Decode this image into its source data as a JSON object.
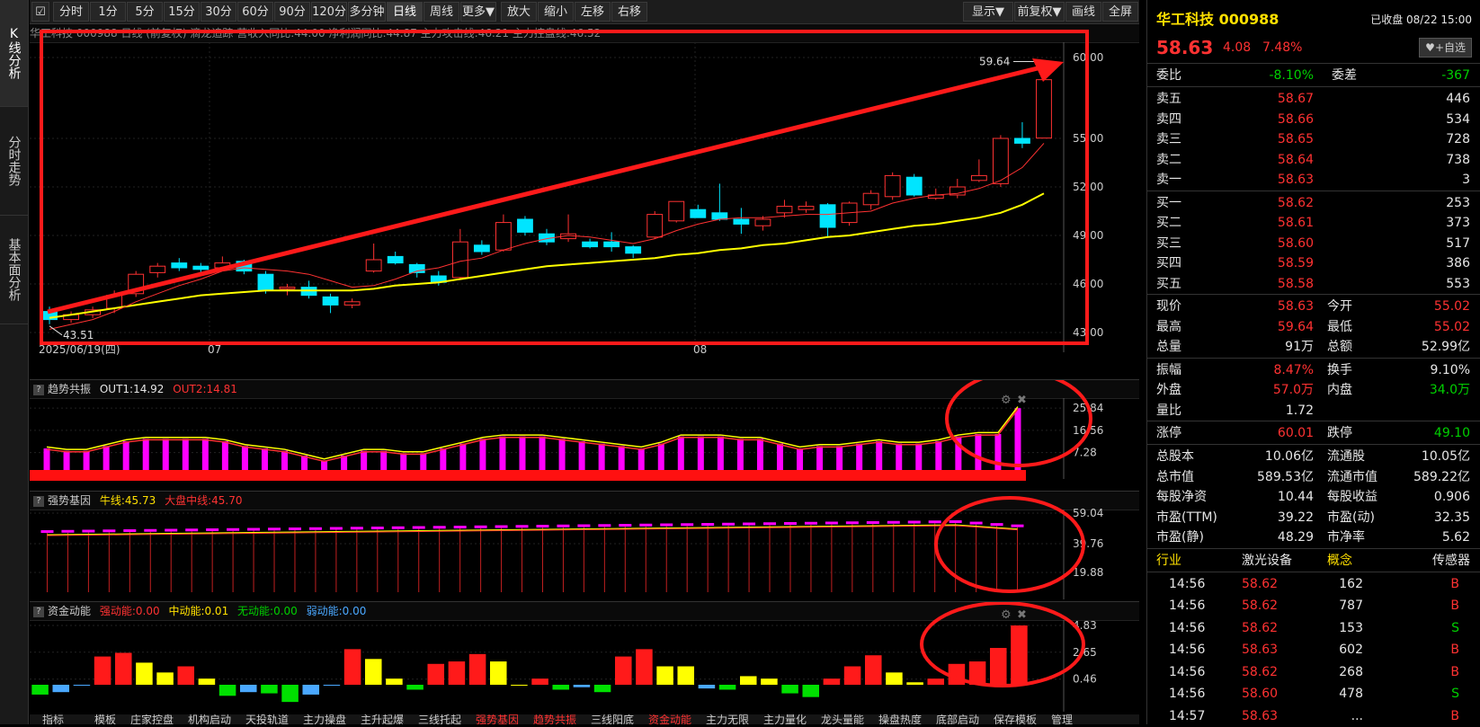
{
  "left_tabs": [
    {
      "label": "K线分析",
      "active": true
    },
    {
      "label": "分时走势",
      "active": false
    },
    {
      "label": "基本面分析",
      "active": false
    }
  ],
  "toolbar": {
    "periods": [
      "分时",
      "1分",
      "5分",
      "15分",
      "30分",
      "60分",
      "90分",
      "120分",
      "多分钟",
      "日线",
      "周线",
      "更多▼"
    ],
    "active_period": "日线",
    "actions": [
      "放大",
      "缩小",
      "左移",
      "右移"
    ],
    "right_actions": [
      "显示▼",
      "前复权▼",
      "画线",
      "全屏"
    ]
  },
  "main_panel": {
    "header": "华工科技 000988 日线 (前复权) 滴龙追踪 营收入同比:44.00 净利润同比:44.87 主力攻击线:46.21 主力控盘线:46.52",
    "y_ticks": [
      "60.00",
      "55.00",
      "52.00",
      "49.00",
      "46.00",
      "43.00"
    ],
    "x_labels": [
      "2025/06/19(四)",
      "07",
      "08"
    ],
    "high_label": "59.64",
    "low_label": "43.51",
    "colors": {
      "up": "#ff3232",
      "down": "#00e5ff",
      "ma5": "#ff3232",
      "ma20": "#ffff00",
      "annotation": "#ff1a1a"
    }
  },
  "chart_data": {
    "type": "candlestick",
    "ylim": [
      42.5,
      60.5
    ],
    "candles": [
      {
        "o": 44.3,
        "h": 44.6,
        "l": 43.51,
        "c": 43.8
      },
      {
        "o": 43.8,
        "h": 44.3,
        "l": 43.6,
        "c": 44.1
      },
      {
        "o": 44.1,
        "h": 44.6,
        "l": 43.9,
        "c": 44.4
      },
      {
        "o": 44.5,
        "h": 45.6,
        "l": 44.2,
        "c": 45.3
      },
      {
        "o": 45.4,
        "h": 46.8,
        "l": 45.2,
        "c": 46.6
      },
      {
        "o": 46.7,
        "h": 47.3,
        "l": 46.4,
        "c": 47.1
      },
      {
        "o": 47.3,
        "h": 47.6,
        "l": 46.8,
        "c": 47.0
      },
      {
        "o": 47.1,
        "h": 47.3,
        "l": 46.7,
        "c": 46.9
      },
      {
        "o": 47.0,
        "h": 47.7,
        "l": 46.9,
        "c": 47.3
      },
      {
        "o": 47.4,
        "h": 47.5,
        "l": 46.6,
        "c": 46.8
      },
      {
        "o": 46.6,
        "h": 46.8,
        "l": 45.4,
        "c": 45.6
      },
      {
        "o": 45.7,
        "h": 46.0,
        "l": 45.3,
        "c": 45.8
      },
      {
        "o": 45.8,
        "h": 46.2,
        "l": 45.1,
        "c": 45.3
      },
      {
        "o": 45.2,
        "h": 45.4,
        "l": 44.2,
        "c": 44.7
      },
      {
        "o": 44.7,
        "h": 45.1,
        "l": 44.5,
        "c": 44.9
      },
      {
        "o": 46.8,
        "h": 48.5,
        "l": 46.7,
        "c": 47.5
      },
      {
        "o": 47.7,
        "h": 48.0,
        "l": 47.2,
        "c": 47.3
      },
      {
        "o": 47.2,
        "h": 47.3,
        "l": 46.4,
        "c": 46.7
      },
      {
        "o": 46.5,
        "h": 46.8,
        "l": 45.9,
        "c": 46.1
      },
      {
        "o": 46.4,
        "h": 49.4,
        "l": 46.3,
        "c": 48.6
      },
      {
        "o": 48.4,
        "h": 48.7,
        "l": 47.8,
        "c": 48.0
      },
      {
        "o": 48.1,
        "h": 50.3,
        "l": 48.0,
        "c": 49.8
      },
      {
        "o": 50.0,
        "h": 50.2,
        "l": 49.0,
        "c": 49.2
      },
      {
        "o": 49.1,
        "h": 49.4,
        "l": 48.4,
        "c": 48.6
      },
      {
        "o": 48.8,
        "h": 50.3,
        "l": 48.6,
        "c": 49.1
      },
      {
        "o": 48.6,
        "h": 48.8,
        "l": 48.2,
        "c": 48.3
      },
      {
        "o": 48.6,
        "h": 49.2,
        "l": 48.0,
        "c": 48.3
      },
      {
        "o": 48.3,
        "h": 48.4,
        "l": 47.6,
        "c": 47.9
      },
      {
        "o": 48.9,
        "h": 50.5,
        "l": 48.8,
        "c": 50.3
      },
      {
        "o": 49.9,
        "h": 51.1,
        "l": 49.8,
        "c": 51.1
      },
      {
        "o": 50.6,
        "h": 50.9,
        "l": 50.1,
        "c": 50.1
      },
      {
        "o": 50.4,
        "h": 52.2,
        "l": 49.9,
        "c": 50.0
      },
      {
        "o": 50.0,
        "h": 50.7,
        "l": 49.1,
        "c": 49.7
      },
      {
        "o": 49.6,
        "h": 50.2,
        "l": 49.3,
        "c": 50.0
      },
      {
        "o": 50.4,
        "h": 51.2,
        "l": 50.1,
        "c": 50.8
      },
      {
        "o": 50.6,
        "h": 51.1,
        "l": 50.4,
        "c": 50.8
      },
      {
        "o": 50.9,
        "h": 51.0,
        "l": 48.9,
        "c": 49.5
      },
      {
        "o": 49.8,
        "h": 51.1,
        "l": 49.6,
        "c": 51.0
      },
      {
        "o": 50.9,
        "h": 51.8,
        "l": 50.6,
        "c": 51.6
      },
      {
        "o": 51.4,
        "h": 52.9,
        "l": 51.2,
        "c": 52.7
      },
      {
        "o": 52.6,
        "h": 52.8,
        "l": 51.4,
        "c": 51.5
      },
      {
        "o": 51.3,
        "h": 51.9,
        "l": 51.2,
        "c": 51.5
      },
      {
        "o": 51.5,
        "h": 52.5,
        "l": 51.3,
        "c": 52.0
      },
      {
        "o": 52.4,
        "h": 53.7,
        "l": 52.3,
        "c": 52.7
      },
      {
        "o": 52.2,
        "h": 55.2,
        "l": 52.0,
        "c": 55.0
      },
      {
        "o": 55.0,
        "h": 56.0,
        "l": 54.4,
        "c": 54.7
      },
      {
        "o": 55.02,
        "h": 59.64,
        "l": 55.02,
        "c": 58.63
      }
    ],
    "ma5": [
      43.2,
      43.5,
      43.8,
      44.3,
      44.9,
      45.4,
      45.9,
      46.3,
      46.8,
      47.0,
      46.9,
      46.8,
      46.6,
      46.2,
      45.8,
      45.9,
      46.3,
      46.8,
      47.0,
      47.4,
      47.6,
      48.1,
      48.5,
      48.8,
      49.0,
      48.9,
      48.7,
      48.5,
      48.8,
      49.3,
      49.7,
      50.0,
      50.1,
      50.1,
      50.2,
      50.3,
      50.3,
      50.4,
      50.5,
      51.0,
      51.3,
      51.5,
      51.6,
      51.9,
      52.4,
      53.2,
      54.7
    ],
    "ma20": [
      43.9,
      44.1,
      44.3,
      44.5,
      44.7,
      44.9,
      45.1,
      45.3,
      45.4,
      45.5,
      45.6,
      45.6,
      45.6,
      45.6,
      45.6,
      45.7,
      45.9,
      46.0,
      46.1,
      46.3,
      46.5,
      46.7,
      46.9,
      47.1,
      47.2,
      47.3,
      47.4,
      47.5,
      47.6,
      47.8,
      47.9,
      48.1,
      48.2,
      48.4,
      48.5,
      48.7,
      48.9,
      49.0,
      49.2,
      49.4,
      49.6,
      49.7,
      49.9,
      50.1,
      50.4,
      50.9,
      51.6
    ]
  },
  "panel2": {
    "title": "趋势共振",
    "out1_label": "OUT1:14.92",
    "out2_label": "OUT2:14.81",
    "y_ticks": [
      "25.84",
      "16.56",
      "7.28"
    ],
    "values": [
      9,
      8,
      8,
      10,
      12,
      13,
      13,
      13,
      13,
      12,
      10,
      9,
      8,
      6,
      4,
      6,
      8,
      8,
      7,
      7,
      9,
      11,
      13,
      14,
      14,
      14,
      13,
      12,
      11,
      10,
      9,
      11,
      14,
      14,
      14,
      13,
      13,
      11,
      9,
      10,
      10,
      11,
      12,
      11,
      11,
      12,
      14,
      15,
      15,
      25.8
    ]
  },
  "panel3": {
    "title": "强势基因",
    "niu_label": "牛线:45.73",
    "dapan_label": "大盘中线:45.70",
    "y_ticks": [
      "59.04",
      "39.76",
      "19.88"
    ]
  },
  "panel4": {
    "title": "资金动能",
    "labels": [
      "强动能:0.00",
      "中动能:0.01",
      "无动能:0.00",
      "弱动能:0.00"
    ],
    "y_ticks": [
      "4.83",
      "2.65",
      "0.46"
    ],
    "bars": [
      {
        "v": -0.8,
        "c": "#00e000"
      },
      {
        "v": -0.6,
        "c": "#4aa8ff"
      },
      {
        "v": 0,
        "c": "#4aa8ff"
      },
      {
        "v": 2.3,
        "c": "#ff1a1a"
      },
      {
        "v": 2.6,
        "c": "#ff1a1a"
      },
      {
        "v": 1.8,
        "c": "#ffff00"
      },
      {
        "v": 1.0,
        "c": "#ffff00"
      },
      {
        "v": 1.5,
        "c": "#ff1a1a"
      },
      {
        "v": 0.5,
        "c": "#ffff00"
      },
      {
        "v": -0.9,
        "c": "#00e000"
      },
      {
        "v": -0.6,
        "c": "#4aa8ff"
      },
      {
        "v": -0.7,
        "c": "#00e000"
      },
      {
        "v": -1.4,
        "c": "#00e000"
      },
      {
        "v": -0.8,
        "c": "#4aa8ff"
      },
      {
        "v": 0,
        "c": "#4aa8ff"
      },
      {
        "v": 2.9,
        "c": "#ff1a1a"
      },
      {
        "v": 2.1,
        "c": "#ffff00"
      },
      {
        "v": 0.5,
        "c": "#ffff00"
      },
      {
        "v": -0.4,
        "c": "#00e000"
      },
      {
        "v": 1.7,
        "c": "#ff1a1a"
      },
      {
        "v": 1.9,
        "c": "#ff1a1a"
      },
      {
        "v": 2.5,
        "c": "#ff1a1a"
      },
      {
        "v": 1.9,
        "c": "#ffff00"
      },
      {
        "v": 0,
        "c": "#ffff00"
      },
      {
        "v": 0.5,
        "c": "#ff1a1a"
      },
      {
        "v": -0.4,
        "c": "#00e000"
      },
      {
        "v": -0.2,
        "c": "#4aa8ff"
      },
      {
        "v": -0.6,
        "c": "#00e000"
      },
      {
        "v": 2.3,
        "c": "#ff1a1a"
      },
      {
        "v": 2.9,
        "c": "#ff1a1a"
      },
      {
        "v": 1.5,
        "c": "#ffff00"
      },
      {
        "v": 1.5,
        "c": "#ffff00"
      },
      {
        "v": -0.3,
        "c": "#4aa8ff"
      },
      {
        "v": -0.4,
        "c": "#00e000"
      },
      {
        "v": 0.7,
        "c": "#ffff00"
      },
      {
        "v": 0.5,
        "c": "#ffff00"
      },
      {
        "v": -0.7,
        "c": "#00e000"
      },
      {
        "v": -1.0,
        "c": "#00e000"
      },
      {
        "v": 0.5,
        "c": "#ff1a1a"
      },
      {
        "v": 1.5,
        "c": "#ff1a1a"
      },
      {
        "v": 2.4,
        "c": "#ff1a1a"
      },
      {
        "v": 1.0,
        "c": "#ffff00"
      },
      {
        "v": 0.2,
        "c": "#ffff00"
      },
      {
        "v": 0.5,
        "c": "#ff1a1a"
      },
      {
        "v": 1.7,
        "c": "#ff1a1a"
      },
      {
        "v": 1.9,
        "c": "#ff1a1a"
      },
      {
        "v": 3.0,
        "c": "#ff1a1a"
      },
      {
        "v": 4.83,
        "c": "#ff1a1a"
      }
    ]
  },
  "bottom_tabs": [
    "指标",
    "模板",
    "庄家控盘",
    "机构启动",
    "天投轨道",
    "主力操盘",
    "主升起爆",
    "三线托起",
    "强势基因",
    "趋势共振",
    "三线阳底",
    "资金动能",
    "主力无限",
    "主力量化",
    "龙头量能",
    "操盘热度",
    "底部启动",
    "保存模板",
    "管理"
  ],
  "quote": {
    "name": "华工科技 000988",
    "status": "已收盘 08/22 15:00",
    "price": "58.63",
    "change": "4.08",
    "change_pct": "7.48%",
    "watch_button": "+自选",
    "weibi_label": "委比",
    "weibi": "-8.10%",
    "weicha_label": "委差",
    "weicha": "-367",
    "asks": [
      {
        "label": "卖五",
        "price": "58.67",
        "vol": "446"
      },
      {
        "label": "卖四",
        "price": "58.66",
        "vol": "534"
      },
      {
        "label": "卖三",
        "price": "58.65",
        "vol": "728"
      },
      {
        "label": "卖二",
        "price": "58.64",
        "vol": "738"
      },
      {
        "label": "卖一",
        "price": "58.63",
        "vol": "3"
      }
    ],
    "bids": [
      {
        "label": "买一",
        "price": "58.62",
        "vol": "253"
      },
      {
        "label": "买二",
        "price": "58.61",
        "vol": "373"
      },
      {
        "label": "买三",
        "price": "58.60",
        "vol": "517"
      },
      {
        "label": "买四",
        "price": "58.59",
        "vol": "386"
      },
      {
        "label": "买五",
        "price": "58.58",
        "vol": "553"
      }
    ],
    "stats": [
      [
        {
          "l": "现价",
          "v": "58.63",
          "c": "red"
        },
        {
          "l": "今开",
          "v": "55.02",
          "c": "red"
        }
      ],
      [
        {
          "l": "最高",
          "v": "59.64",
          "c": "red"
        },
        {
          "l": "最低",
          "v": "55.02",
          "c": "red"
        }
      ],
      [
        {
          "l": "总量",
          "v": "91万",
          "c": "white"
        },
        {
          "l": "总额",
          "v": "52.99亿",
          "c": "white"
        }
      ]
    ],
    "stats2": [
      [
        {
          "l": "振幅",
          "v": "8.47%",
          "c": "red"
        },
        {
          "l": "换手",
          "v": "9.10%",
          "c": "white"
        }
      ],
      [
        {
          "l": "外盘",
          "v": "57.0万",
          "c": "red"
        },
        {
          "l": "内盘",
          "v": "34.0万",
          "c": "green"
        }
      ],
      [
        {
          "l": "量比",
          "v": "1.72",
          "c": "white"
        }
      ]
    ],
    "limit": [
      {
        "l": "涨停",
        "v": "60.01",
        "c": "red"
      },
      {
        "l": "跌停",
        "v": "49.10",
        "c": "green"
      }
    ],
    "fundamentals": [
      [
        {
          "l": "总股本",
          "v": "10.06亿"
        },
        {
          "l": "流通股",
          "v": "10.05亿"
        }
      ],
      [
        {
          "l": "总市值",
          "v": "589.53亿"
        },
        {
          "l": "流通市值",
          "v": "589.22亿"
        }
      ],
      [
        {
          "l": "每股净资",
          "v": "10.44"
        },
        {
          "l": "每股收益",
          "v": "0.906"
        }
      ],
      [
        {
          "l": "市盈(TTM)",
          "v": "39.22"
        },
        {
          "l": "市盈(动)",
          "v": "32.35"
        }
      ],
      [
        {
          "l": "市盈(静)",
          "v": "48.29"
        },
        {
          "l": "市净率",
          "v": "5.62"
        }
      ]
    ],
    "industry_label": "行业",
    "industry": "激光设备",
    "concept_label": "概念",
    "concept": "传感器",
    "ticks": [
      {
        "t": "14:56",
        "p": "58.62",
        "v": "162",
        "s": "B"
      },
      {
        "t": "14:56",
        "p": "58.62",
        "v": "787",
        "s": "B"
      },
      {
        "t": "14:56",
        "p": "58.62",
        "v": "153",
        "s": "S"
      },
      {
        "t": "14:56",
        "p": "58.63",
        "v": "602",
        "s": "B"
      },
      {
        "t": "14:56",
        "p": "58.62",
        "v": "268",
        "s": "B"
      },
      {
        "t": "14:56",
        "p": "58.60",
        "v": "478",
        "s": "S"
      },
      {
        "t": "14:57",
        "p": "58.63",
        "v": "...",
        "s": "B"
      }
    ]
  }
}
